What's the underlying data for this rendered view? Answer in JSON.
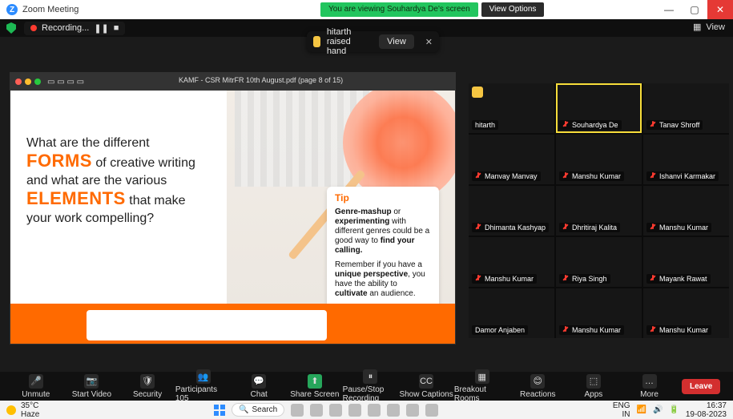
{
  "topbar": {
    "app_title": "Zoom Meeting",
    "viewing_banner": "You are viewing Souhardya De's screen",
    "view_options": "View Options"
  },
  "status": {
    "recording": "Recording...",
    "view": "View"
  },
  "raised_hand": {
    "text": "hitarth raised hand",
    "view": "View"
  },
  "share": {
    "doc_title": "KAMF - CSR MitrFR 10th August.pdf (page 8 of 15)",
    "slide": {
      "line1": "What are the different",
      "forms": "FORMS",
      "line2": "of creative writing",
      "line3": "and what are the various",
      "elements": "ELEMENTS",
      "line4": "that make",
      "line5": "your work compelling?"
    },
    "tip": {
      "title": "Tip",
      "p1_part1": "Genre-mashup",
      "p1_part2": "or",
      "p1_part3": "experimenting",
      "p1_part4": "with different genres could be a good way to",
      "p1_part5": "find your calling.",
      "p2_part1": "Remember if you have a",
      "p2_part2": "unique perspective",
      "p2_part3": ", you have the ability to",
      "p2_part4": "cultivate",
      "p2_part5": "an audience."
    }
  },
  "participants": [
    {
      "name": "hitarth",
      "muted": false,
      "raised": true
    },
    {
      "name": "Souhardya De",
      "muted": true,
      "raised": false,
      "active": true
    },
    {
      "name": "Tanav Shroff",
      "muted": true,
      "raised": false
    },
    {
      "name": "Manvay Manvay",
      "muted": true,
      "raised": false
    },
    {
      "name": "Manshu Kumar",
      "muted": true,
      "raised": false
    },
    {
      "name": "Ishanvi Karmakar",
      "muted": true,
      "raised": false
    },
    {
      "name": "Dhimanta Kashyap",
      "muted": true,
      "raised": false
    },
    {
      "name": "Dhritiraj Kalita",
      "muted": true,
      "raised": false
    },
    {
      "name": "Manshu Kumar",
      "muted": true,
      "raised": false
    },
    {
      "name": "Manshu Kumar",
      "muted": true,
      "raised": false
    },
    {
      "name": "Riya Singh",
      "muted": true,
      "raised": false
    },
    {
      "name": "Mayank Rawat",
      "muted": true,
      "raised": false
    },
    {
      "name": "Damor Anjaben",
      "muted": false,
      "raised": false
    },
    {
      "name": "Manshu Kumar",
      "muted": true,
      "raised": false
    },
    {
      "name": "Manshu Kumar",
      "muted": true,
      "raised": false
    }
  ],
  "controls": {
    "unmute": "Unmute",
    "start_video": "Start Video",
    "security": "Security",
    "participants": "Participants",
    "participants_count": "105",
    "chat": "Chat",
    "share_screen": "Share Screen",
    "pause_stop_recording": "Pause/Stop Recording",
    "show_captions": "Show Captions",
    "breakout_rooms": "Breakout Rooms",
    "reactions": "Reactions",
    "apps": "Apps",
    "more": "More",
    "leave": "Leave"
  },
  "taskbar": {
    "temp": "35°C",
    "weather": "Haze",
    "search": "Search",
    "lang1": "ENG",
    "lang2": "IN",
    "time": "16:37",
    "date": "19-08-2023"
  },
  "colors": {
    "accent": "#ff6a00",
    "active_outline": "#f7dd3a"
  }
}
